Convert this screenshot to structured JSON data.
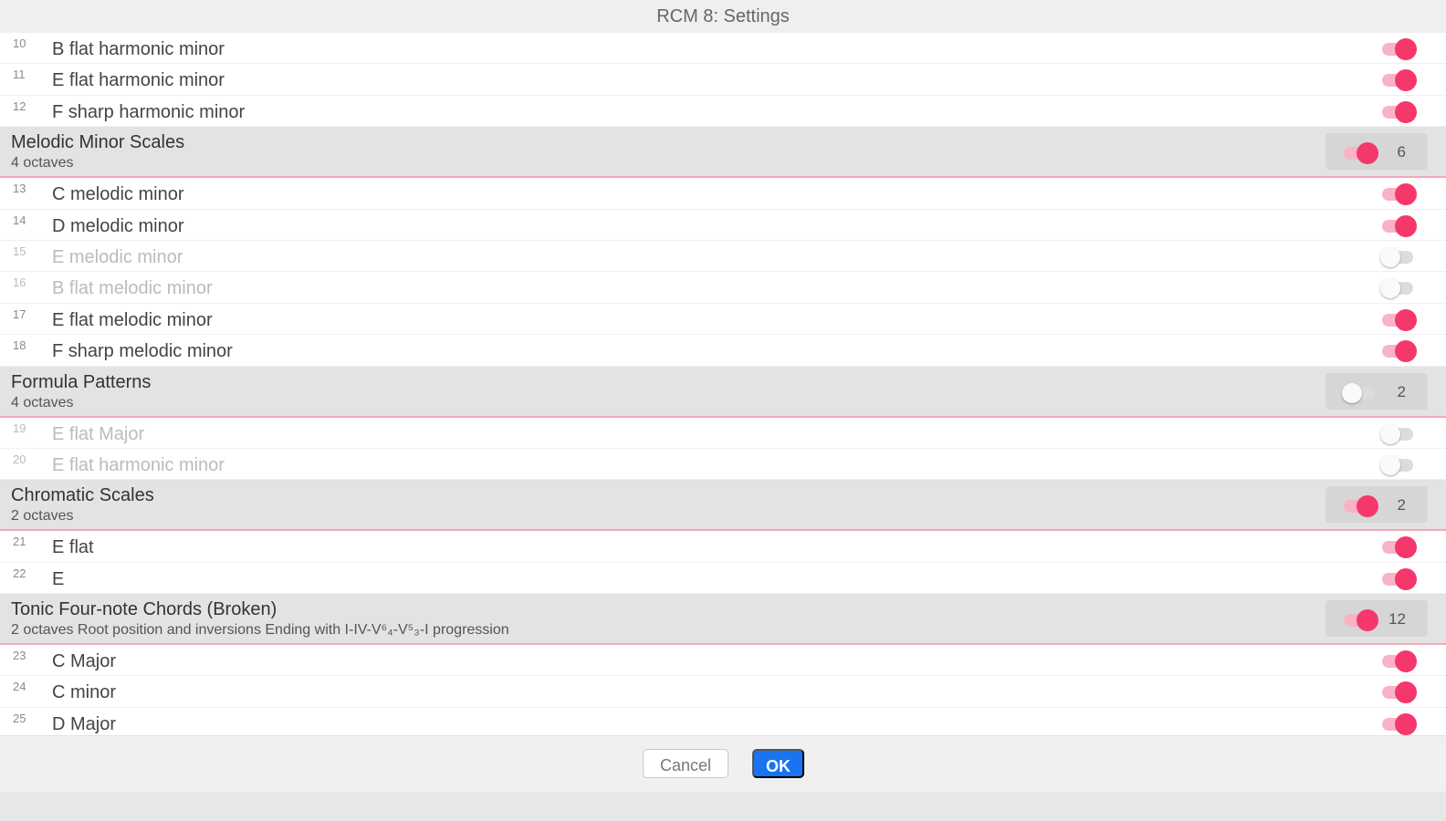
{
  "window": {
    "title": "RCM 8: Settings"
  },
  "groups": [
    {
      "header": null,
      "items": [
        {
          "num": "10",
          "label": "B flat harmonic minor",
          "on": true
        },
        {
          "num": "11",
          "label": "E flat harmonic minor",
          "on": true
        },
        {
          "num": "12",
          "label": "F sharp harmonic minor",
          "on": true
        }
      ]
    },
    {
      "header": {
        "title": "Melodic Minor Scales",
        "subtitle": "4 octaves",
        "on": true,
        "count": "6"
      },
      "items": [
        {
          "num": "13",
          "label": "C melodic minor",
          "on": true
        },
        {
          "num": "14",
          "label": "D melodic minor",
          "on": true
        },
        {
          "num": "15",
          "label": "E melodic minor",
          "on": false
        },
        {
          "num": "16",
          "label": "B flat melodic minor",
          "on": false
        },
        {
          "num": "17",
          "label": "E flat melodic minor",
          "on": true
        },
        {
          "num": "18",
          "label": "F sharp melodic minor",
          "on": true
        }
      ]
    },
    {
      "header": {
        "title": "Formula Patterns",
        "subtitle": "4 octaves",
        "on": false,
        "count": "2"
      },
      "items": [
        {
          "num": "19",
          "label": "E flat Major",
          "on": false
        },
        {
          "num": "20",
          "label": "E flat harmonic minor",
          "on": false
        }
      ]
    },
    {
      "header": {
        "title": "Chromatic Scales",
        "subtitle": "2 octaves",
        "on": true,
        "count": "2"
      },
      "items": [
        {
          "num": "21",
          "label": "E flat",
          "on": true
        },
        {
          "num": "22",
          "label": "E",
          "on": true
        }
      ]
    },
    {
      "header": {
        "title": "Tonic Four-note Chords (Broken)",
        "subtitle": "2 octaves  Root position and inversions  Ending with I-IV-V⁶₄-V⁵₃-I progression",
        "on": true,
        "count": "12"
      },
      "items": [
        {
          "num": "23",
          "label": "C Major",
          "on": true
        },
        {
          "num": "24",
          "label": "C minor",
          "on": true
        },
        {
          "num": "25",
          "label": "D Major",
          "on": true
        }
      ]
    }
  ],
  "footer": {
    "cancel_label": "Cancel",
    "ok_label": "OK"
  },
  "colors": {
    "accent": "#f5386b",
    "accent_track": "#f8b4c6",
    "ok_button": "#1a73f0",
    "header_bg": "#e3e3e3"
  }
}
